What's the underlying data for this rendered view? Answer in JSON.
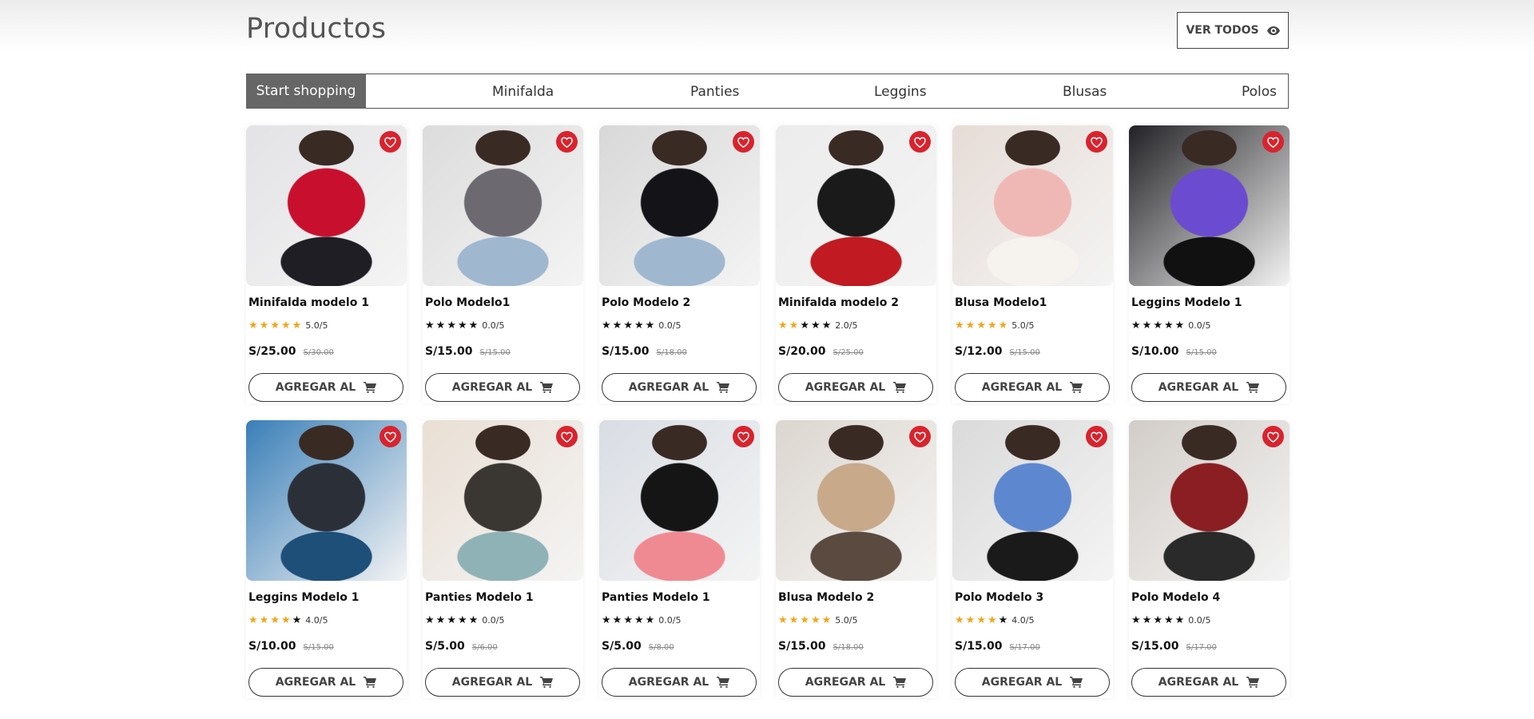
{
  "header": {
    "title": "Productos",
    "view_all_label": "VER TODOS"
  },
  "tabs": [
    {
      "label": "Start shopping",
      "active": true
    },
    {
      "label": "Minifalda"
    },
    {
      "label": "Panties"
    },
    {
      "label": "Leggins"
    },
    {
      "label": "Blusas"
    },
    {
      "label": "Polos"
    }
  ],
  "cart_label": "AGREGAR AL",
  "products": [
    {
      "name": "Minifalda modelo 1",
      "stars": 5,
      "rating_text": "5.0/5",
      "price": "S/25.00",
      "old_price": "S/30.00",
      "img_colors": [
        "#e3e3e6",
        "#c8102e",
        "#1e1e24"
      ]
    },
    {
      "name": "Polo Modelo1",
      "stars": 0,
      "rating_text": "0.0/5",
      "price": "S/15.00",
      "old_price": "S/15.00",
      "img_colors": [
        "#dcdcdc",
        "#6c6a70",
        "#9fb8d0"
      ]
    },
    {
      "name": "Polo Modelo 2",
      "stars": 0,
      "rating_text": "0.0/5",
      "price": "S/15.00",
      "old_price": "S/18.00",
      "img_colors": [
        "#d8d8d8",
        "#141418",
        "#9fb8d0"
      ]
    },
    {
      "name": "Minifalda modelo 2",
      "stars": 2,
      "rating_text": "2.0/5",
      "price": "S/20.00",
      "old_price": "S/25.00",
      "img_colors": [
        "#ececec",
        "#1a1a1a",
        "#c11a22"
      ]
    },
    {
      "name": "Blusa Modelo1",
      "stars": 5,
      "rating_text": "5.0/5",
      "price": "S/12.00",
      "old_price": "S/15.00",
      "img_colors": [
        "#e6dcd6",
        "#f0b8b4",
        "#f6f2ee"
      ]
    },
    {
      "name": "Leggins Modelo 1",
      "stars": 0,
      "rating_text": "0.0/5",
      "price": "S/10.00",
      "old_price": "S/15.00",
      "img_colors": [
        "#222226",
        "#6b4bd0",
        "#111"
      ]
    },
    {
      "name": "Leggins Modelo 1",
      "stars": 4,
      "rating_text": "4.0/5",
      "price": "S/10.00",
      "old_price": "S/15.00",
      "img_colors": [
        "#3a7fb8",
        "#2b2f38",
        "#1d4f78"
      ]
    },
    {
      "name": "Panties Modelo 1",
      "stars": 0,
      "rating_text": "0.0/5",
      "price": "S/5.00",
      "old_price": "S/6.00",
      "img_colors": [
        "#e9dfd4",
        "#3a3632",
        "#8fb2b6"
      ]
    },
    {
      "name": "Panties Modelo 1",
      "stars": 0,
      "rating_text": "0.0/5",
      "price": "S/5.00",
      "old_price": "S/8.00",
      "img_colors": [
        "#d9dde4",
        "#151515",
        "#f08a92"
      ]
    },
    {
      "name": "Blusa Modelo 2",
      "stars": 5,
      "rating_text": "5.0/5",
      "price": "S/15.00",
      "old_price": "S/18.00",
      "img_colors": [
        "#dcd6cf",
        "#c8a98a",
        "#5a4a40"
      ]
    },
    {
      "name": "Polo Modelo 3",
      "stars": 4,
      "rating_text": "4.0/5",
      "price": "S/15.00",
      "old_price": "S/17.00",
      "img_colors": [
        "#dadada",
        "#5d87cf",
        "#1a1a1a"
      ]
    },
    {
      "name": "Polo Modelo 4",
      "stars": 0,
      "rating_text": "0.0/5",
      "price": "S/15.00",
      "old_price": "S/17.00",
      "img_colors": [
        "#d2cdc8",
        "#8a1e22",
        "#2a2a2a"
      ]
    }
  ]
}
